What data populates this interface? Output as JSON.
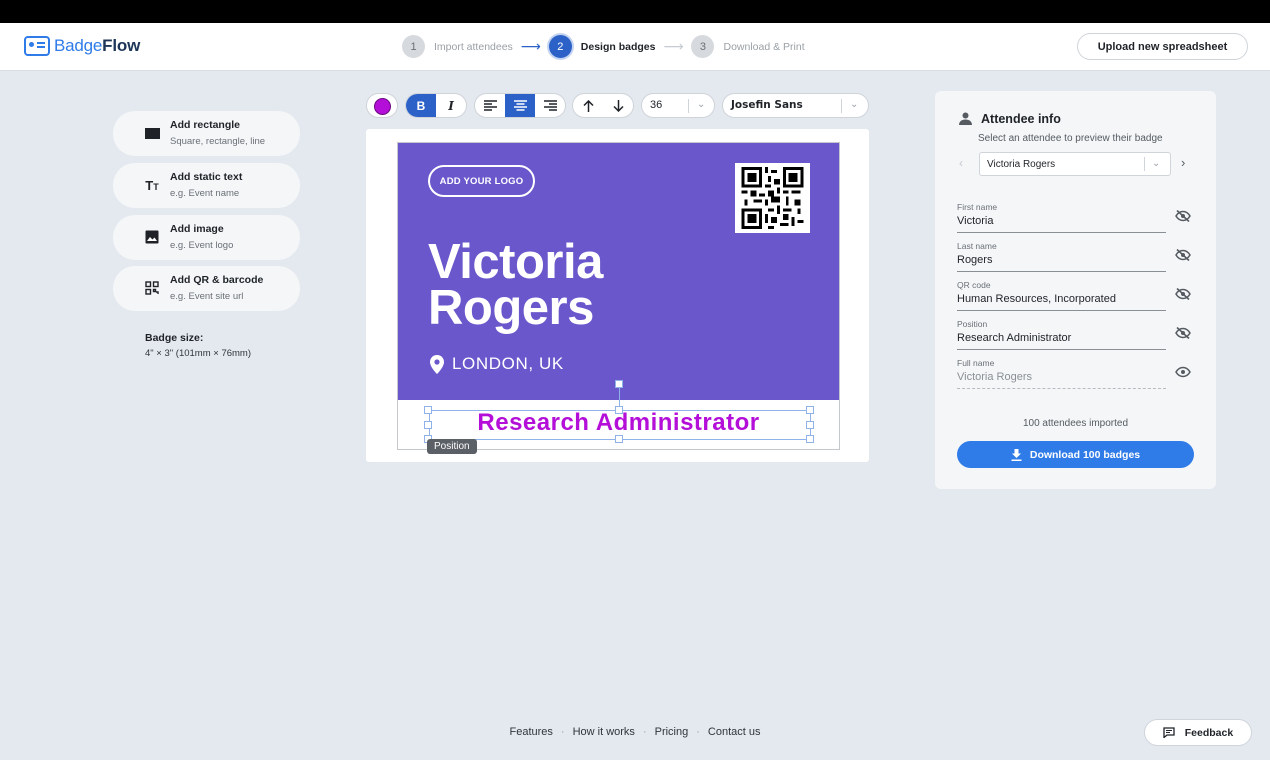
{
  "brand": {
    "name_a": "Badge",
    "name_b": "Flow",
    "accent": "#2f7be8"
  },
  "steps": [
    {
      "num": "1",
      "label": "Import attendees"
    },
    {
      "num": "2",
      "label": "Design badges"
    },
    {
      "num": "3",
      "label": "Download & Print"
    }
  ],
  "header": {
    "upload_label": "Upload new spreadsheet"
  },
  "tools": [
    {
      "title": "Add rectangle",
      "sub": "Square, rectangle, line",
      "icon": "rectangle-icon"
    },
    {
      "title": "Add static text",
      "sub": "e.g. Event name",
      "icon": "text-icon"
    },
    {
      "title": "Add image",
      "sub": "e.g. Event logo",
      "icon": "image-icon"
    },
    {
      "title": "Add QR & barcode",
      "sub": "e.g. Event site url",
      "icon": "qr-icon"
    }
  ],
  "badge_size": {
    "title": "Badge size:",
    "value": "4\" × 3\" (101mm × 76mm)"
  },
  "toolbar": {
    "text_color": "#b40fd8",
    "bold": "B",
    "italic": "I",
    "font_size": "36",
    "font_family": "Josefin Sans"
  },
  "badge": {
    "logo_label": "ADD YOUR LOGO",
    "first_name": "Victoria",
    "last_name": "Rogers",
    "location": "LONDON, UK",
    "position": "Research Administrator",
    "background": "#6a57cc",
    "position_tip": "Position"
  },
  "attendee_panel": {
    "title": "Attendee info",
    "subtitle": "Select an attendee to preview their badge",
    "selected": "Victoria Rogers",
    "fields": [
      {
        "label": "First name",
        "value": "Victoria",
        "visible": false
      },
      {
        "label": "Last name",
        "value": "Rogers",
        "visible": false
      },
      {
        "label": "QR code",
        "value": "Human Resources, Incorporated",
        "visible": false
      },
      {
        "label": "Position",
        "value": "Research Administrator",
        "visible": false
      },
      {
        "label": "Full name",
        "value": "Victoria Rogers",
        "visible": true
      }
    ],
    "imported": "100 attendees imported",
    "download_label": "Download 100 badges"
  },
  "footer": {
    "links": [
      "Features",
      "How it works",
      "Pricing",
      "Contact us"
    ],
    "feedback_label": "Feedback"
  }
}
